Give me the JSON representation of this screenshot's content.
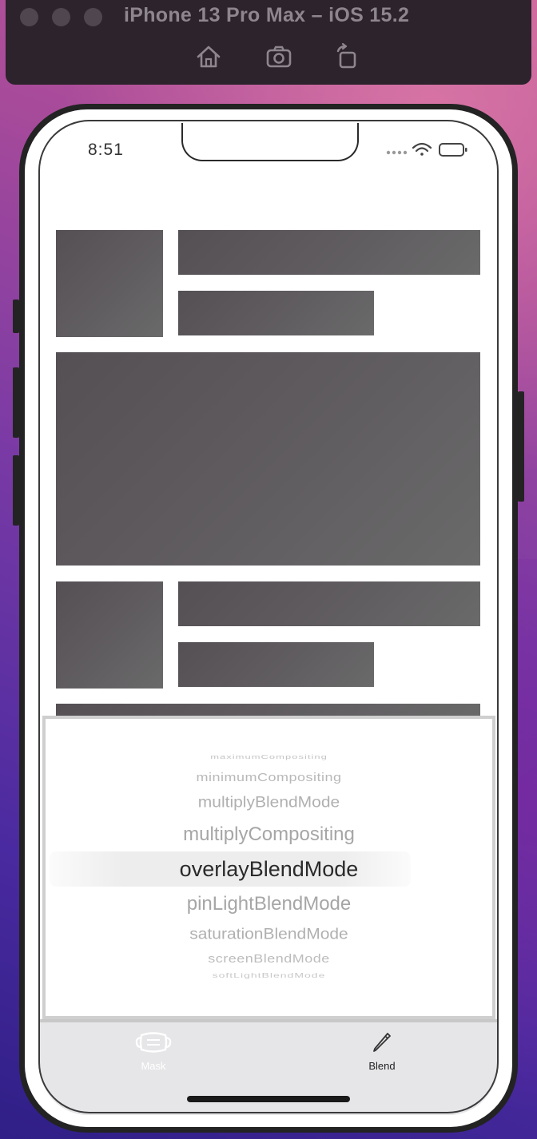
{
  "simulator": {
    "title": "iPhone 13 Pro Max – iOS 15.2",
    "toolbar_icons": [
      "home-icon",
      "screenshot-camera-icon",
      "rotate-icon"
    ]
  },
  "status_bar": {
    "time": "8:51",
    "icons": [
      "signal-dots-icon",
      "wifi-icon",
      "battery-icon"
    ]
  },
  "picker": {
    "items": [
      "maximumCompositing",
      "minimumCompositing",
      "multiplyBlendMode",
      "multiplyCompositing",
      "overlayBlendMode",
      "pinLightBlendMode",
      "saturationBlendMode",
      "screenBlendMode",
      "softLightBlendMode"
    ],
    "selected": "overlayBlendMode"
  },
  "tab_bar": {
    "tabs": [
      {
        "label": "Mask",
        "icon": "face-mask-icon"
      },
      {
        "label": "Blend",
        "icon": "pencil-icon"
      }
    ],
    "selected": "Blend",
    "active_color": "#222222",
    "inactive_color": "#ffffff"
  }
}
